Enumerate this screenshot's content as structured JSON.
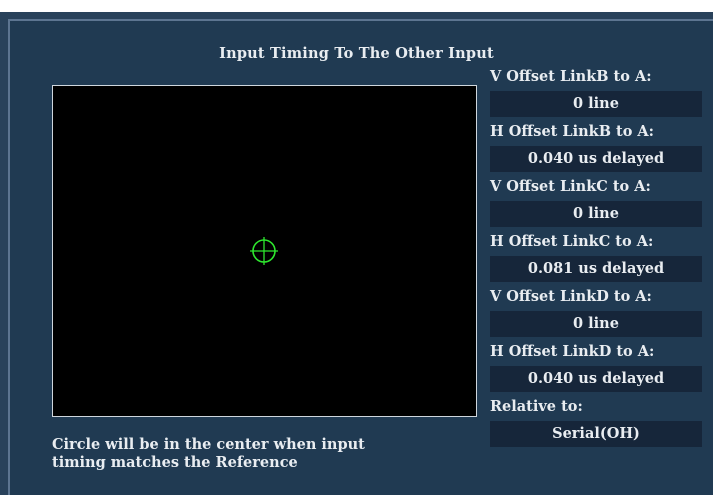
{
  "title": "Input Timing To The Other Input",
  "info_rows": [
    {
      "label": "V Offset LinkB to A:",
      "value": "0 line"
    },
    {
      "label": "H Offset LinkB to A:",
      "value": "0.040 us delayed"
    },
    {
      "label": "V Offset LinkC to A:",
      "value": "0 line"
    },
    {
      "label": "H Offset LinkC to A:",
      "value": "0.081 us delayed"
    },
    {
      "label": "V Offset LinkD to A:",
      "value": "0 line"
    },
    {
      "label": "H Offset LinkD to A:",
      "value": "0.040 us delayed"
    },
    {
      "label": "Relative to:",
      "value": "Serial(OH)"
    }
  ],
  "note": {
    "line1": "Circle will be in the center when input",
    "line2": "timing matches the Reference"
  },
  "colors": {
    "crosshair": "#2ee62e",
    "background": "#203a52",
    "value_box": "#16263a",
    "display": "#000000"
  },
  "icons": {
    "timing_marker": "crosshair-circle-icon"
  }
}
